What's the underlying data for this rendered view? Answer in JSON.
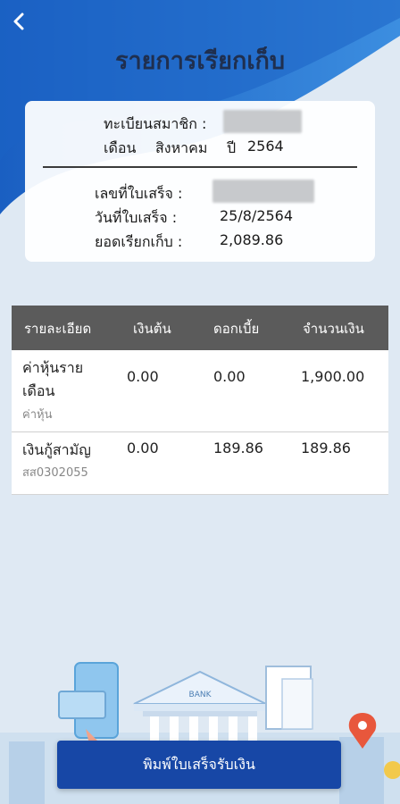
{
  "header": {
    "title": "รายการเรียกเก็บ",
    "back_icon": "chevron-left-icon"
  },
  "info": {
    "member_label": "ทะเบียนสมาชิก :",
    "month_label": "เดือน",
    "month_value": "สิงหาคม",
    "year_label": "ปี",
    "year_value": "2564",
    "receipt_no_label": "เลขที่ใบเสร็จ :",
    "receipt_date_label": "วันที่ใบเสร็จ :",
    "receipt_date_value": "25/8/2564",
    "amount_label": "ยอดเรียกเก็บ :",
    "amount_value": "2,089.86"
  },
  "table": {
    "headers": [
      "รายละเอียด",
      "เงินต้น",
      "ดอกเบี้ย",
      "จำนวนเงิน"
    ],
    "rows": [
      {
        "detail_line1": "ค่าหุ้นราย",
        "detail_line2": "เดือน",
        "detail_sub": "ค่าหุ้น",
        "principal": "0.00",
        "interest": "0.00",
        "amount": "1,900.00"
      },
      {
        "detail_line1": "เงินกู้สามัญ",
        "detail_sub": "สส0302055",
        "principal": "0.00",
        "interest": "189.86",
        "amount": "189.86"
      }
    ]
  },
  "illustration": {
    "bank_sign": "BANK"
  },
  "footer": {
    "print_label": "พิมพ์ใบเสร็จรับเงิน"
  },
  "colors": {
    "primary": "#1747a6",
    "header_blue": "#1b63c4",
    "table_header": "#5b5b5b",
    "background": "#dfe9f3"
  }
}
